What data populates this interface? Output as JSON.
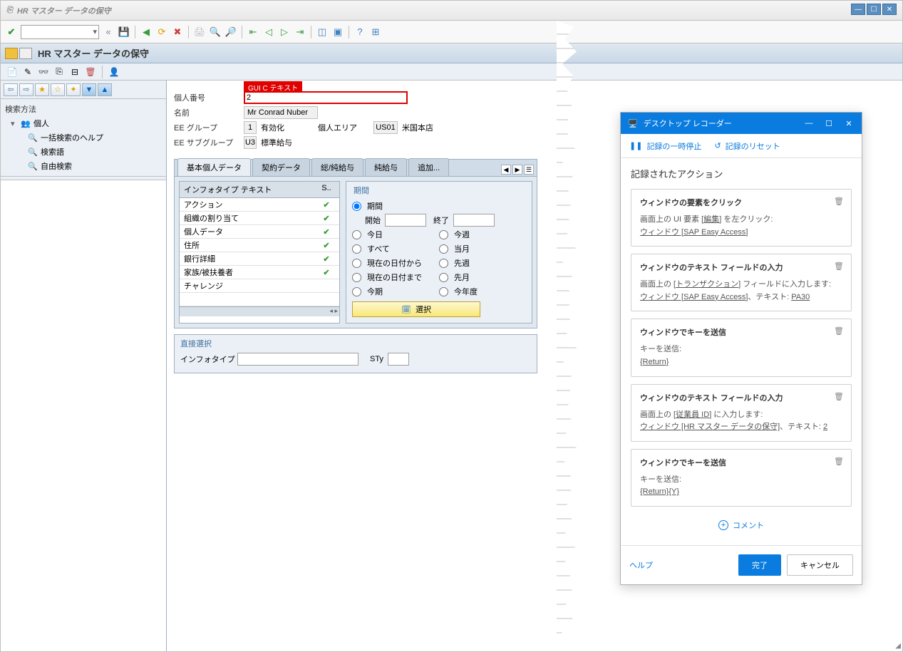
{
  "window": {
    "title": "HR マスター データの保守"
  },
  "subheader": {
    "title": "HR マスター データの保守"
  },
  "tree": {
    "header": "検索方法",
    "root": "個人",
    "children": [
      "一括検索のヘルプ",
      "検索語",
      "自由検索"
    ]
  },
  "form": {
    "highlight_label": "GUI C テキスト",
    "personal_number_label": "個人番号",
    "personal_number_value": "2",
    "name_label": "名前",
    "name_value": "Mr Conrad Nuber",
    "ee_group_label": "EE グループ",
    "ee_group_code": "1",
    "ee_group_text": "有効化",
    "personal_area_label": "個人エリア",
    "personal_area_code": "US01",
    "personal_area_text": "米国本店",
    "ee_subgroup_label": "EE サブグループ",
    "ee_subgroup_code": "U3",
    "ee_subgroup_text": "標準給与"
  },
  "tabs": [
    "基本個人データ",
    "契約データ",
    "総/純給与",
    "純給与",
    "追加..."
  ],
  "infotable": {
    "header_text": "インフォタイプ テキスト",
    "header_status": "S..",
    "rows": [
      {
        "text": "アクション",
        "check": true
      },
      {
        "text": "組織の割り当て",
        "check": true
      },
      {
        "text": "個人データ",
        "check": true
      },
      {
        "text": "住所",
        "check": true
      },
      {
        "text": "銀行詳細",
        "check": true
      },
      {
        "text": "家族/被扶養者",
        "check": true
      },
      {
        "text": "チャレンジ",
        "check": false
      },
      {
        "text": "",
        "check": false
      }
    ]
  },
  "period": {
    "header": "期間",
    "period_label": "期間",
    "start_label": "開始",
    "end_label": "終了",
    "today": "今日",
    "this_week": "今週",
    "all": "すべて",
    "this_month": "当月",
    "from_current": "現在の日付から",
    "last_week": "先週",
    "to_current": "現在の日付まで",
    "last_month": "先月",
    "this_period": "今期",
    "this_year": "今年度",
    "select_btn": "選択"
  },
  "direct": {
    "header": "直接選択",
    "infotype_label": "インフォタイプ",
    "sty_label": "STy"
  },
  "recorder": {
    "title": "デスクトップ レコーダー",
    "pause": "記録の一時停止",
    "reset": "記録のリセット",
    "heading": "記録されたアクション",
    "actions": [
      {
        "title": "ウィンドウの要素をクリック",
        "body_prefix": "画面上の UI 要素 [編集] を左クリック:",
        "body_link": "ウィンドウ [SAP Easy Access]"
      },
      {
        "title": "ウィンドウのテキスト フィールドの入力",
        "body_prefix": "画面上の [トランザクション] フィールドに入力します:",
        "body_link": "ウィンドウ [SAP Easy Access]",
        "body_suffix": "、テキスト: PA30"
      },
      {
        "title": "ウィンドウでキーを送信",
        "body_prefix": "キーを送信: ",
        "body_link": "{Return}"
      },
      {
        "title": "ウィンドウのテキスト フィールドの入力",
        "body_prefix": "画面上の [従業員 ID] に入力します:",
        "body_link": "ウィンドウ [HR マスター データの保守]",
        "body_suffix": "、テキスト: 2"
      },
      {
        "title": "ウィンドウでキーを送信",
        "body_prefix": "キーを送信: ",
        "body_link": "{Return}{Y}"
      }
    ],
    "comment": "コメント",
    "help": "ヘルプ",
    "done": "完了",
    "cancel": "キャンセル"
  }
}
